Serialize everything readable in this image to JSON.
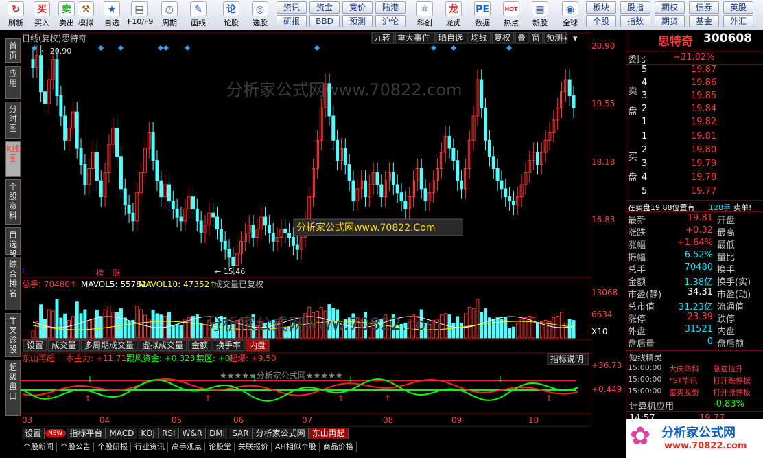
{
  "toolbar": {
    "buttons": [
      {
        "label": "刷新",
        "icon": "refresh-icon",
        "glyph": "↻",
        "color": "#cc2020"
      },
      {
        "label": "买入",
        "icon": "buy-icon",
        "glyph": "买",
        "color": "#e02020"
      },
      {
        "label": "卖出",
        "icon": "sell-icon",
        "glyph": "卖",
        "color": "#20a020"
      },
      {
        "label": "模拟",
        "icon": "hammer-icon",
        "glyph": "⚒",
        "color": "#a05010"
      },
      {
        "label": "自选",
        "icon": "star-icon",
        "glyph": "★",
        "color": "#2060c0"
      },
      {
        "label": "F10/F9",
        "icon": "f10-icon",
        "glyph": "▤",
        "color": "#2060c0"
      },
      {
        "label": "周期",
        "icon": "clock-icon",
        "glyph": "◷",
        "color": "#2060c0"
      },
      {
        "label": "画线",
        "icon": "pen-icon",
        "glyph": "✎",
        "color": "#2060c0"
      },
      {
        "label": "论股",
        "icon": "talk-icon",
        "glyph": "论",
        "color": "#2060c0"
      },
      {
        "label": "选股",
        "icon": "select-icon",
        "glyph": "◎",
        "color": "#2060c0"
      },
      {
        "label": "科创",
        "icon": "kechuang-icon",
        "glyph": "⚛",
        "color": "#2060c0"
      },
      {
        "label": "龙虎",
        "icon": "dragon-icon",
        "glyph": "龙",
        "color": "#e02020"
      },
      {
        "label": "数据",
        "icon": "pe-icon",
        "glyph": "PE",
        "color": "#2060c0"
      },
      {
        "label": "热点",
        "icon": "hot-icon",
        "glyph": "HOT",
        "color": "#e02020"
      },
      {
        "label": "新股",
        "icon": "newstock-icon",
        "glyph": "▦",
        "color": "#2060c0"
      },
      {
        "label": "全球",
        "icon": "globe-icon",
        "glyph": "◉",
        "color": "#2060c0"
      }
    ],
    "grid1": [
      "资讯",
      "资金",
      "竞价",
      "陆港",
      "研报",
      "BBD",
      "预测",
      "沪伦"
    ],
    "grid2": [
      "板块",
      "股指",
      "期权",
      "债券",
      "英股",
      "个股",
      "指数",
      "期货",
      "基金",
      "外汇"
    ]
  },
  "left_tabs": [
    "首页",
    "应用",
    "分时图",
    "K线图",
    "个股资料",
    "自选股",
    "综合排名",
    "牛叉诊股",
    "超级盘口"
  ],
  "chart": {
    "title": "日线(复权)",
    "stock_name": "思特奇",
    "header_buttons": [
      "九转",
      "重大事件",
      "晒自选",
      "均线",
      "复权",
      "叠",
      "窗",
      "预测"
    ],
    "price_axis": [
      "20.90",
      "19.55",
      "18.18",
      "16.83"
    ],
    "high_label": "20.90",
    "low_label": "15.46",
    "marks": [
      "L",
      "榜",
      "涨"
    ],
    "watermark_main": "分析家公式网www.70822.com",
    "watermark_banner": "分析家公式网www.70822.Com",
    "vol_header": {
      "total": "总手: 70480↑",
      "mavol5": "MAVOL5: 55782↑",
      "mavol10": "MAVOL10: 47352↑",
      "note": "成交量已复权"
    },
    "vol_axis": [
      "13068",
      "6634",
      "X10"
    ],
    "vol_tabs": [
      "设置",
      "成交量",
      "多周期成交量",
      "虚拟成交量",
      "金额",
      "换手率",
      "内盘"
    ],
    "ind_header": {
      "name": "东山再起",
      "main": "一本主力: +11.71↑",
      "follow": "跟风资金: +0.323↑",
      "ban": "禁区: +0",
      "rise": "起爆: +9.50"
    },
    "ind_button": "指标说明",
    "ind_axis": [
      "+36.73",
      "+0.449"
    ],
    "ind_watermark": "★★★★★分析家公式网★★★★★",
    "months": [
      "03",
      "04",
      "05",
      "06",
      "07",
      "08",
      "09",
      "10"
    ],
    "bottom_tabs": [
      "设置",
      "NEW",
      "指标平台",
      "MACD",
      "KDJ",
      "RSI",
      "W&R",
      "DMI",
      "SAR",
      "分析家公式网",
      "东山再起"
    ],
    "news_tabs": [
      "个股新闻",
      "个股公告",
      "个股研报",
      "行业资讯",
      "高手观点",
      "论股堂",
      "关联报价",
      "AH相似个股",
      "商品价格"
    ]
  },
  "panel": {
    "name": "思特奇",
    "code": "300608",
    "weibi_label": "委比",
    "weibi": "+31.82%",
    "sell_label": "卖盘",
    "buy_label": "买盘",
    "sell": [
      {
        "n": "5",
        "p": "19.87"
      },
      {
        "n": "4",
        "p": "19.86"
      },
      {
        "n": "3",
        "p": "19.85"
      },
      {
        "n": "2",
        "p": "19.84"
      },
      {
        "n": "1",
        "p": "19.82"
      }
    ],
    "buy": [
      {
        "n": "1",
        "p": "19.81"
      },
      {
        "n": "2",
        "p": "19.80"
      },
      {
        "n": "3",
        "p": "19.79"
      },
      {
        "n": "4",
        "p": "19.78"
      },
      {
        "n": "5",
        "p": "19.77"
      }
    ],
    "sell_order": {
      "text": "在卖盘19.88位置有",
      "qty": "128手",
      "label": "卖单!"
    },
    "quotes": [
      {
        "l": "最新",
        "v": "19.81",
        "vc": "red",
        "r": "开盘"
      },
      {
        "l": "涨跌",
        "v": "+0.32",
        "vc": "red",
        "r": "最高"
      },
      {
        "l": "涨幅",
        "v": "+1.64%",
        "vc": "red",
        "r": "最低"
      },
      {
        "l": "振幅",
        "v": "6.52%",
        "vc": "cyan",
        "r": "量比"
      },
      {
        "l": "总手",
        "v": "70480",
        "vc": "cyan",
        "r": "换手"
      },
      {
        "l": "金额",
        "v": "1.38亿",
        "vc": "cyan",
        "r": "换手(实)"
      },
      {
        "l": "市盈(静)",
        "v": "34.31",
        "vc": "wht",
        "r": "市盈(动)"
      },
      {
        "l": "总市值",
        "v": "31.23亿",
        "vc": "cyan",
        "r": "流通值"
      },
      {
        "l": "涨停",
        "v": "23.39",
        "vc": "red",
        "r": "跌停"
      },
      {
        "l": "外盘",
        "v": "31521",
        "vc": "cyan",
        "r": "内盘"
      },
      {
        "l": "盘后量",
        "v": "0",
        "vc": "cyan",
        "r": "盘后额"
      }
    ],
    "short_title": "短线精灵",
    "short_items": [
      {
        "t": "15:00:00",
        "n": "大庆华科",
        "e": "急速拉升"
      },
      {
        "t": "15:00:00",
        "n": "*ST华讯",
        "e": "打开跌停板"
      },
      {
        "t": "15:00:00",
        "n": "富奥股份",
        "e": "打开涨停板"
      }
    ],
    "sector": {
      "name": "计算机应用",
      "chg": "-0.83%"
    },
    "tick": {
      "time": "14:57",
      "price": "19.77"
    }
  },
  "brand": "分析家公式网",
  "brand_url": "www.70822.com"
}
